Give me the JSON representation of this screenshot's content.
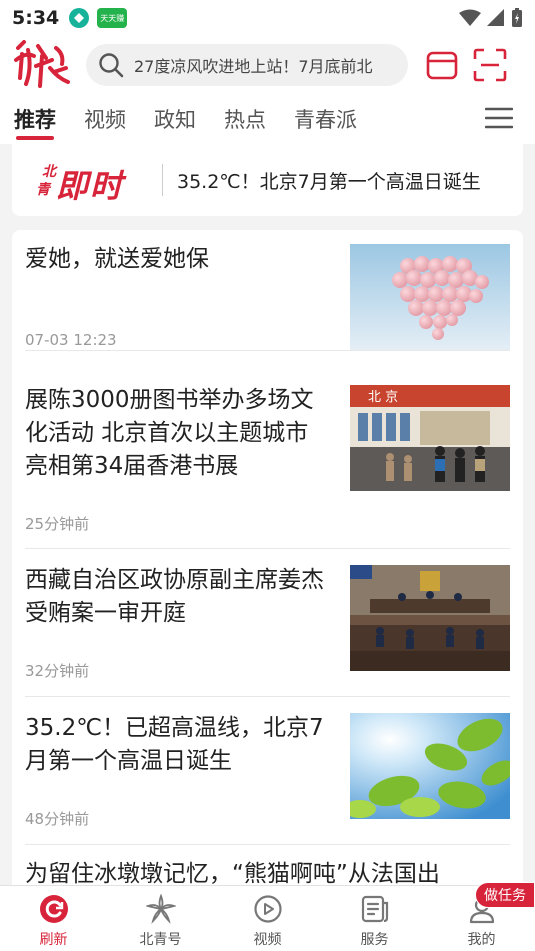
{
  "status_bar": {
    "time": "5:34",
    "app_badge": "天天赚"
  },
  "header": {
    "search_placeholder": "27度凉风吹进地上站！7月底前北"
  },
  "tabs": [
    {
      "label": "推荐",
      "active": true
    },
    {
      "label": "视频",
      "active": false
    },
    {
      "label": "政知",
      "active": false
    },
    {
      "label": "热点",
      "active": false
    },
    {
      "label": "青春派",
      "active": false
    }
  ],
  "breaking": {
    "logo_small_1": "北",
    "logo_small_2": "青",
    "logo_big": "即时",
    "headline": "35.2℃！北京7月第一个高温日诞生"
  },
  "feed": [
    {
      "title": "爱她，就送爱她保",
      "time": "07-03 12:23",
      "thumb_icon": "heart-balloons-image"
    },
    {
      "title": "展陈3000册图书举办多场文化活动 北京首次以主题城市亮相第34届香港书展",
      "time": "25分钟前",
      "thumb_icon": "book-fair-image"
    },
    {
      "title": "西藏自治区政协原副主席姜杰受贿案一审开庭",
      "time": "32分钟前",
      "thumb_icon": "courtroom-image"
    },
    {
      "title": "35.2℃！已超高温线，北京7月第一个高温日诞生",
      "time": "48分钟前",
      "thumb_icon": "sunlit-leaves-image"
    },
    {
      "title": "为留住冰墩墩记忆，“熊猫啊吨”从法国出"
    }
  ],
  "bottom_nav": [
    {
      "label": "刷新",
      "icon": "refresh-icon",
      "active": true
    },
    {
      "label": "北青号",
      "icon": "flower-icon",
      "active": false
    },
    {
      "label": "视频",
      "icon": "play-icon",
      "active": false
    },
    {
      "label": "服务",
      "icon": "services-icon",
      "active": false
    },
    {
      "label": "我的",
      "icon": "user-icon",
      "active": false
    }
  ],
  "task_badge": "做任务",
  "colors": {
    "brand_red": "#d8243a"
  }
}
